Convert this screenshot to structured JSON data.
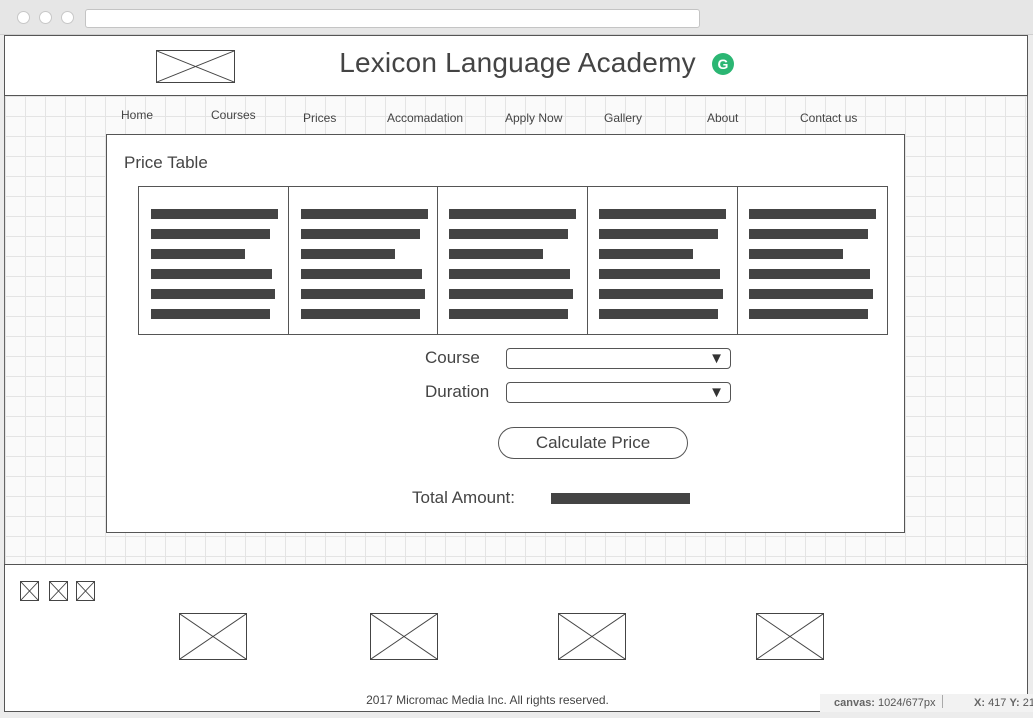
{
  "site": {
    "title": "Lexicon Language Academy"
  },
  "header": {
    "extension_icon_glyph": "G",
    "extension_icon_color": "#2bb673"
  },
  "nav": {
    "items": [
      "Home",
      "Courses",
      "Prices",
      "Accomadation",
      "Apply Now",
      "Gallery",
      "About",
      "Contact us"
    ]
  },
  "main": {
    "section_title": "Price Table",
    "form": {
      "course_label": "Course",
      "course_value": "",
      "duration_label": "Duration",
      "duration_value": "",
      "dropdown_arrow": "▼",
      "calculate_label": "Calculate Price",
      "total_label": "Total Amount:"
    }
  },
  "footer": {
    "copyright": "2017 Micromac Media Inc. All rights reserved."
  },
  "status_bar": {
    "canvas_label": "canvas:",
    "canvas_value": "1024/677px",
    "x_label": "X:",
    "x_value": "417",
    "y_label": "Y:",
    "y_value": "21"
  }
}
